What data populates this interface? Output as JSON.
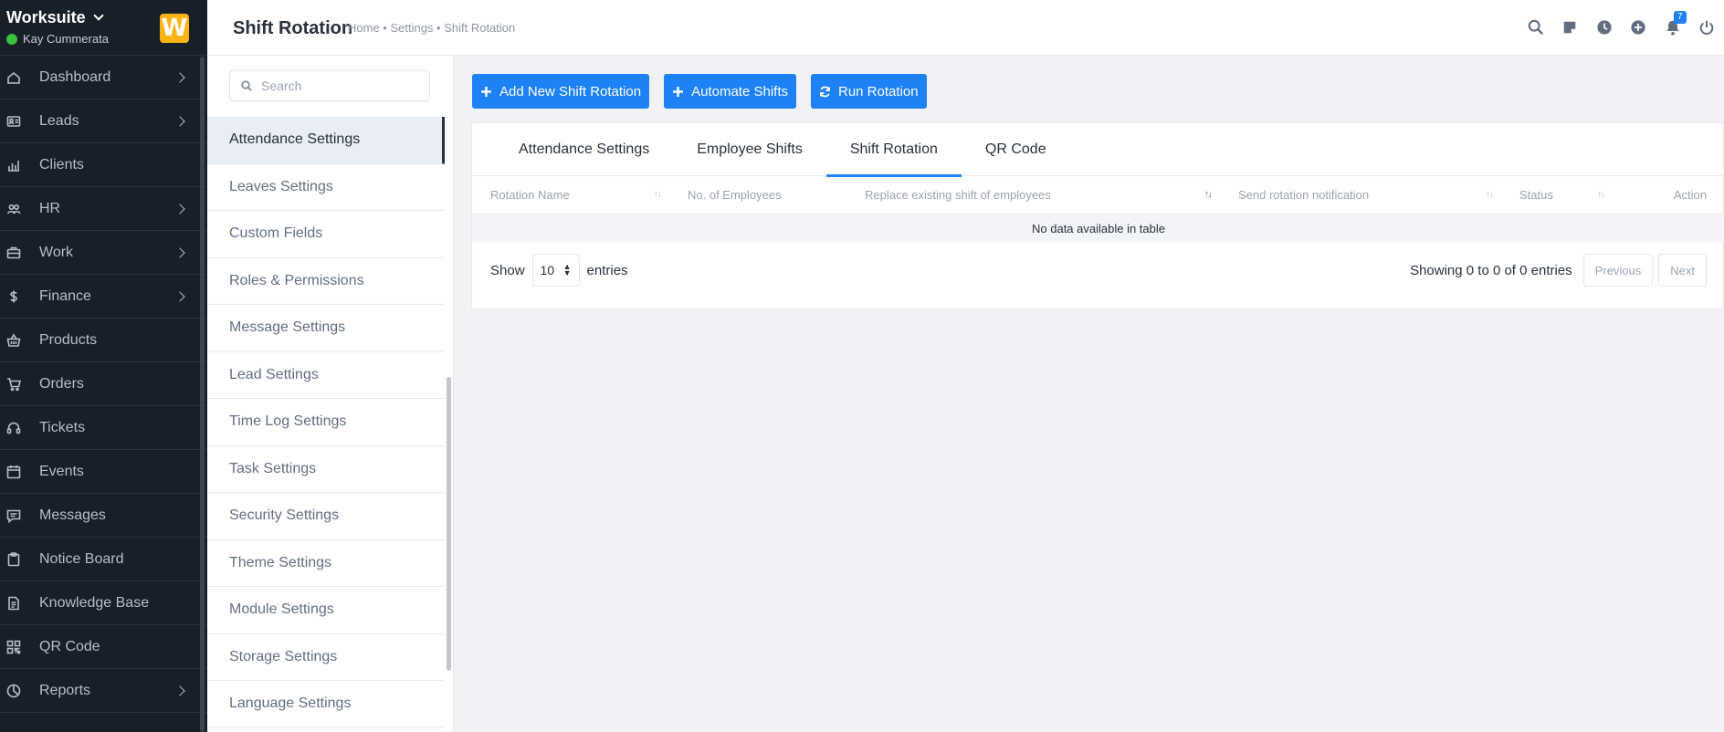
{
  "app": {
    "name": "Worksuite",
    "user": "Kay Cummerata",
    "logo_letter": "W",
    "logo_color": "#fcb415",
    "online_color": "#39c03d"
  },
  "sidebar": {
    "items": [
      {
        "label": "Dashboard",
        "icon": "home-icon",
        "has_arrow": true
      },
      {
        "label": "Leads",
        "icon": "id-card-icon",
        "has_arrow": true
      },
      {
        "label": "Clients",
        "icon": "bar-chart-icon",
        "has_arrow": false
      },
      {
        "label": "HR",
        "icon": "people-icon",
        "has_arrow": true
      },
      {
        "label": "Work",
        "icon": "briefcase-icon",
        "has_arrow": true
      },
      {
        "label": "Finance",
        "icon": "dollar-icon",
        "has_arrow": true
      },
      {
        "label": "Products",
        "icon": "basket-icon",
        "has_arrow": false
      },
      {
        "label": "Orders",
        "icon": "cart-icon",
        "has_arrow": false
      },
      {
        "label": "Tickets",
        "icon": "headset-icon",
        "has_arrow": false
      },
      {
        "label": "Events",
        "icon": "calendar-icon",
        "has_arrow": false
      },
      {
        "label": "Messages",
        "icon": "message-icon",
        "has_arrow": false
      },
      {
        "label": "Notice Board",
        "icon": "clipboard-icon",
        "has_arrow": false
      },
      {
        "label": "Knowledge Base",
        "icon": "document-icon",
        "has_arrow": false
      },
      {
        "label": "QR Code",
        "icon": "qr-code-icon",
        "has_arrow": false
      },
      {
        "label": "Reports",
        "icon": "pie-chart-icon",
        "has_arrow": true
      }
    ]
  },
  "header": {
    "title": "Shift Rotation",
    "breadcrumb": "Home • Settings • Shift Rotation",
    "notification_count": "7",
    "icons": [
      "search-icon",
      "sticky-note-icon",
      "clock-icon",
      "plus-circle-icon",
      "bell-icon",
      "power-icon"
    ]
  },
  "settings_menu": {
    "search_placeholder": "Search",
    "items": [
      "Attendance Settings",
      "Leaves Settings",
      "Custom Fields",
      "Roles & Permissions",
      "Message Settings",
      "Lead Settings",
      "Time Log Settings",
      "Task Settings",
      "Security Settings",
      "Theme Settings",
      "Module Settings",
      "Storage Settings",
      "Language Settings"
    ],
    "active": "Attendance Settings"
  },
  "actions": {
    "add_label": "Add New Shift Rotation",
    "automate_label": "Automate Shifts",
    "run_label": "Run Rotation"
  },
  "tabs": {
    "items": [
      "Attendance Settings",
      "Employee Shifts",
      "Shift Rotation",
      "QR Code"
    ],
    "active": "Shift Rotation"
  },
  "table": {
    "columns": [
      "Rotation Name",
      "No. of Employees",
      "Replace existing shift of employees",
      "Send rotation notification",
      "Status",
      "Action"
    ],
    "empty_message": "No data available in table",
    "show_label": "Show",
    "page_size": "10",
    "entries_label": "entries",
    "info": "Showing 0 to 0 of 0 entries",
    "prev_label": "Previous",
    "next_label": "Next"
  },
  "colors": {
    "primary": "#1d82f5",
    "sidebar_bg": "#171f29"
  }
}
